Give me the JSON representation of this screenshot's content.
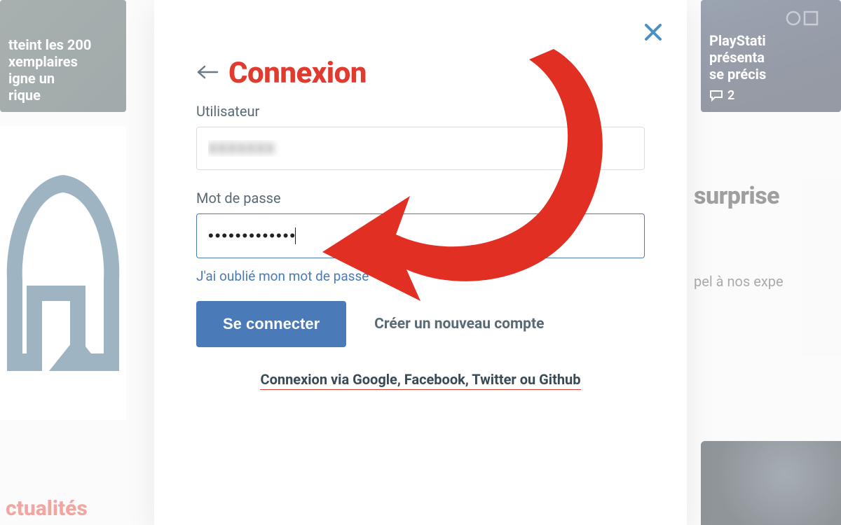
{
  "background": {
    "left_card": {
      "line1": "tteint les 200",
      "line2": "xemplaires",
      "line3": "igne un",
      "line4": "rique"
    },
    "right_card": {
      "line1": "PlayStati",
      "line2": "présenta",
      "line3": "se précis",
      "comments": "2"
    },
    "right_text": {
      "headline": "surprise",
      "sub": "pel à nos expe"
    },
    "section_label": "ctualités"
  },
  "modal": {
    "title": "Connexion",
    "username_label": "Utilisateur",
    "username_value": "XXXXXXX",
    "password_label": "Mot de passe",
    "password_value": "•••••••••••••",
    "forgot_label": "J'ai oublié mon mot de passe",
    "submit_label": "Se connecter",
    "create_label": "Créer un nouveau compte",
    "social_label": "Connexion via Google, Facebook, Twitter ou Github"
  }
}
